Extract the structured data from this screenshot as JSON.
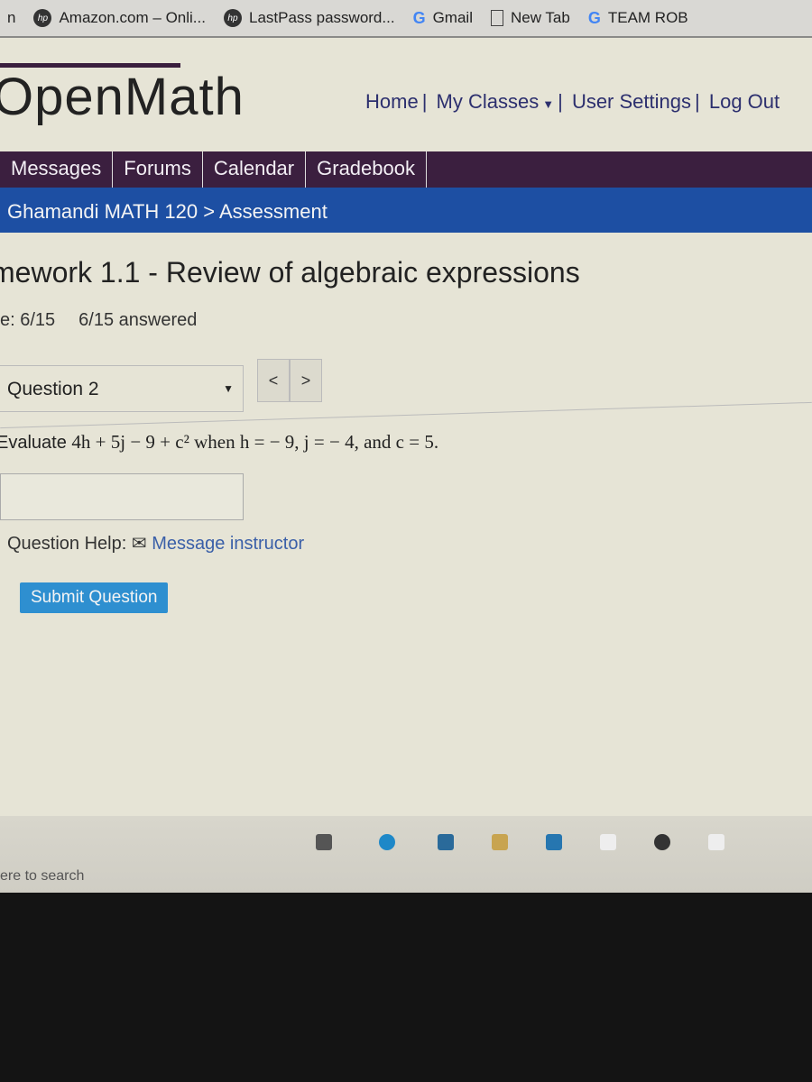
{
  "bookmarks": [
    {
      "label": "Amazon.com – Onli...",
      "icon": "hp-icon"
    },
    {
      "label": "LastPass password...",
      "icon": "hp-icon"
    },
    {
      "label": "Gmail",
      "icon": "google-icon"
    },
    {
      "label": "New Tab",
      "icon": "page-icon"
    },
    {
      "label": "TEAM ROB",
      "icon": "google-icon"
    }
  ],
  "site": {
    "logo": "OpenMath",
    "nav": {
      "home": "Home",
      "classes": "My Classes",
      "settings": "User Settings",
      "logout": "Log Out"
    }
  },
  "tabs": [
    "Messages",
    "Forums",
    "Calendar",
    "Gradebook"
  ],
  "breadcrumb": "Ghamandi MATH 120 > Assessment",
  "assessment": {
    "title": "mework 1.1 - Review of algebraic expressions",
    "score": "e: 6/15",
    "answered": "6/15 answered"
  },
  "question": {
    "selected": "Question 2",
    "prev": "<",
    "next": ">",
    "prompt": "Evaluate",
    "expr": "4h + 5j − 9 + c² when h = − 9, j = − 4, and c = 5.",
    "answer": "",
    "help_label": "Question Help:",
    "message_link": "Message instructor",
    "submit": "Submit Question"
  },
  "taskbar": {
    "search_placeholder": "ere to search"
  }
}
